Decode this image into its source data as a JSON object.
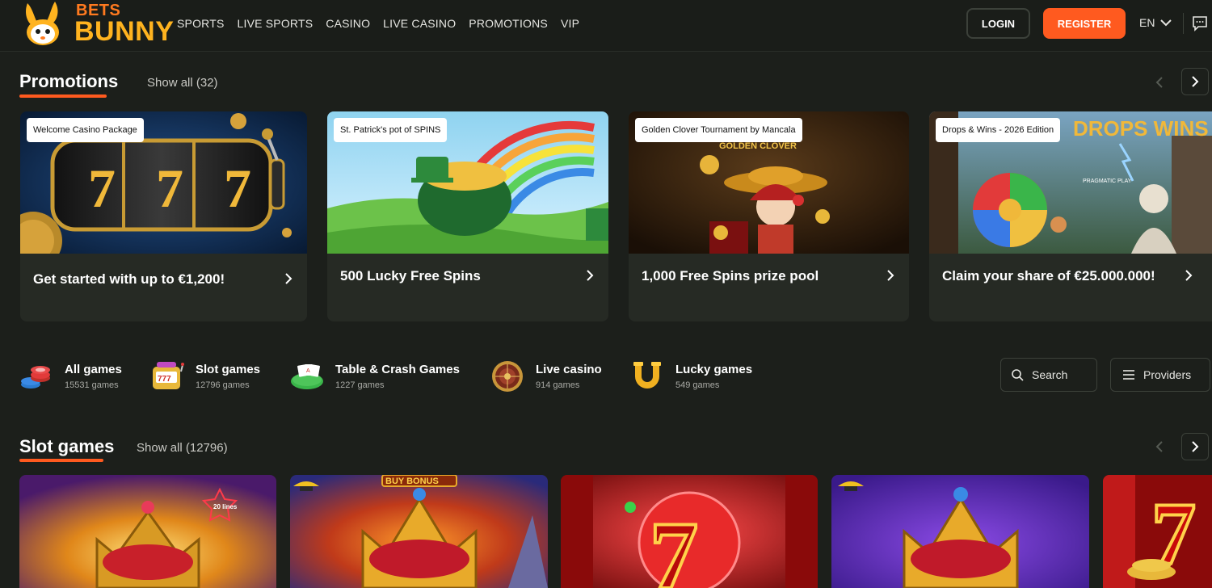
{
  "header": {
    "logo": {
      "line1": "BETS",
      "line2": "BUNNY"
    },
    "nav": [
      "SPORTS",
      "LIVE SPORTS",
      "CASINO",
      "LIVE CASINO",
      "PROMOTIONS",
      "VIP"
    ],
    "login_label": "LOGIN",
    "register_label": "REGISTER",
    "language": "EN",
    "icons": {
      "language_toggle": "chevron-down-icon",
      "chat": "chat-icon"
    },
    "colors": {
      "register": "#ff5a1f",
      "logo_bets": "#ff7a1f",
      "logo_bunny": "#ffb31f"
    }
  },
  "promotions": {
    "title": "Promotions",
    "show_all": "Show all (32)",
    "cards": [
      {
        "tag": "Welcome Casino Package",
        "text": "Get started with up to €1,200!"
      },
      {
        "tag": "St. Patrick's pot of SPINS",
        "text": "500 Lucky Free Spins"
      },
      {
        "tag": "Golden Clover Tournament by Mancala",
        "text": "1,000 Free Spins prize pool",
        "image_text": "GOLDEN CLOVER"
      },
      {
        "tag": "Drops & Wins - 2026 Edition",
        "text": "Claim your share of €25.000.000!",
        "image_text": "DROPS WINS",
        "image_subtext": "PRAGMATIC PLAY"
      }
    ]
  },
  "categories": [
    {
      "name": "All games",
      "count": "15531 games",
      "icon": "chips-icon"
    },
    {
      "name": "Slot games",
      "count": "12796 games",
      "icon": "slot-machine-icon"
    },
    {
      "name": "Table & Crash Games",
      "count": "1227 games",
      "icon": "cards-table-icon"
    },
    {
      "name": "Live casino",
      "count": "914 games",
      "icon": "roulette-icon"
    },
    {
      "name": "Lucky games",
      "count": "549 games",
      "icon": "horseshoe-icon"
    }
  ],
  "tools": {
    "search_label": "Search",
    "providers_label": "Providers"
  },
  "slot_games": {
    "title": "Slot games",
    "show_all": "Show all (12796)",
    "tiles": [
      {
        "art": "crown",
        "badge": "20 lines"
      },
      {
        "art": "crown",
        "banner": "BUY BONUS"
      },
      {
        "art": "seven"
      },
      {
        "art": "crown"
      },
      {
        "art": "seven"
      }
    ]
  }
}
